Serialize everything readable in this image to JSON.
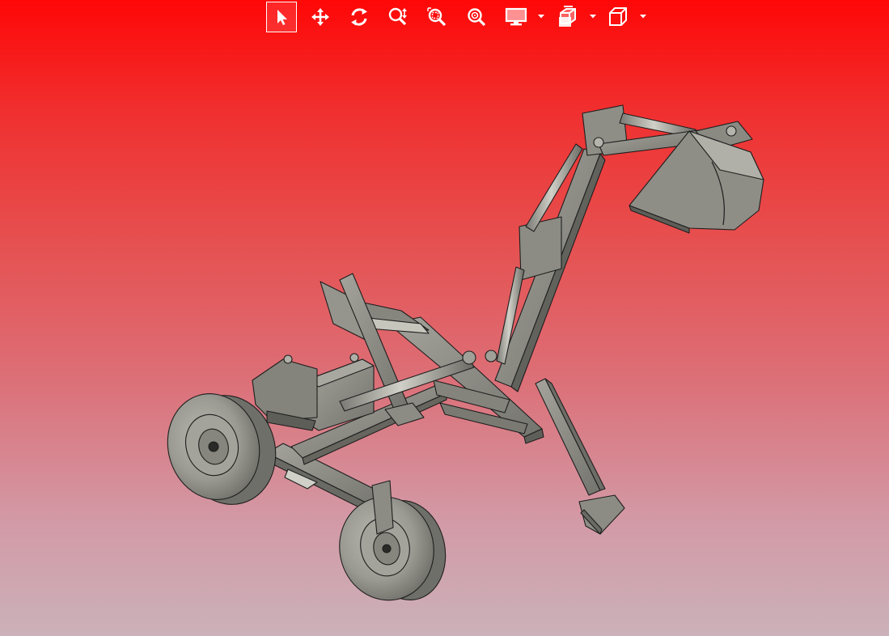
{
  "toolbar": {
    "tools": [
      {
        "id": "select",
        "icon": "arrow-pointer-icon",
        "active": true
      },
      {
        "id": "pan",
        "icon": "move-arrows-icon",
        "active": false
      },
      {
        "id": "rotate",
        "icon": "rotate-icon",
        "active": false
      },
      {
        "id": "zoom",
        "icon": "zoom-updown-icon",
        "active": false
      },
      {
        "id": "zoom-window",
        "icon": "zoom-window-icon",
        "active": false
      },
      {
        "id": "zoom-fit",
        "icon": "zoom-fit-icon",
        "active": false
      },
      {
        "id": "display-style",
        "icon": "monitor-icon",
        "active": false,
        "dropdown": true
      },
      {
        "id": "section-view",
        "icon": "section-cube-icon",
        "active": false,
        "dropdown": true
      },
      {
        "id": "view-orientation",
        "icon": "cube-icon",
        "active": false,
        "dropdown": true
      }
    ]
  },
  "colors": {
    "background_top": "#ff0707",
    "background_bottom": "#cbb1b9",
    "model_fill": "#8a8a82",
    "model_edge": "#1e1e1e",
    "toolbar_icon": "#ffffff"
  },
  "viewport": {
    "model": "backhoe-attachment-assembly"
  }
}
